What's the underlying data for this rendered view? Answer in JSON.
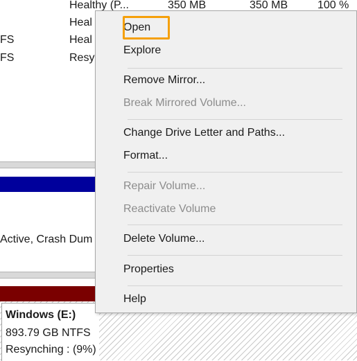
{
  "volume_list": {
    "rows": [
      {
        "fs": "",
        "status": "Healthy (P...",
        "capacity": "350 MB",
        "free": "350 MB",
        "pct": "100 %"
      },
      {
        "fs": "",
        "status": "Heal",
        "capacity": "",
        "free": "",
        "pct": ""
      },
      {
        "fs": "FS",
        "status": "Heal",
        "capacity": "",
        "free": "",
        "pct": ""
      },
      {
        "fs": "FS",
        "status": "Resy",
        "capacity": "",
        "free": "",
        "pct": ""
      }
    ]
  },
  "disk_map": {
    "partition_status_text": "Active, Crash Dum",
    "volume": {
      "name": "Windows  (E:)",
      "size": "893.79 GB NTFS",
      "status": "Resynching : (9%)"
    }
  },
  "context_menu": {
    "items": [
      {
        "label": "Open",
        "enabled": true,
        "focused": true
      },
      {
        "label": "Explore",
        "enabled": true
      },
      {
        "label": "Remove Mirror...",
        "enabled": true
      },
      {
        "label": "Break Mirrored Volume...",
        "enabled": false
      },
      {
        "label": "Change Drive Letter and Paths...",
        "enabled": true
      },
      {
        "label": "Format...",
        "enabled": true
      },
      {
        "label": "Repair Volume...",
        "enabled": false
      },
      {
        "label": "Reactivate Volume",
        "enabled": false
      },
      {
        "label": "Delete Volume...",
        "enabled": true
      },
      {
        "label": "Properties",
        "enabled": true
      },
      {
        "label": "Help",
        "enabled": true
      }
    ]
  },
  "colors": {
    "focus_ring": "#f5a00a",
    "simple_volume_bar": "#00009c",
    "mirrored_volume_bar": "#7a0000",
    "disabled_text": "#8c8c8c"
  }
}
